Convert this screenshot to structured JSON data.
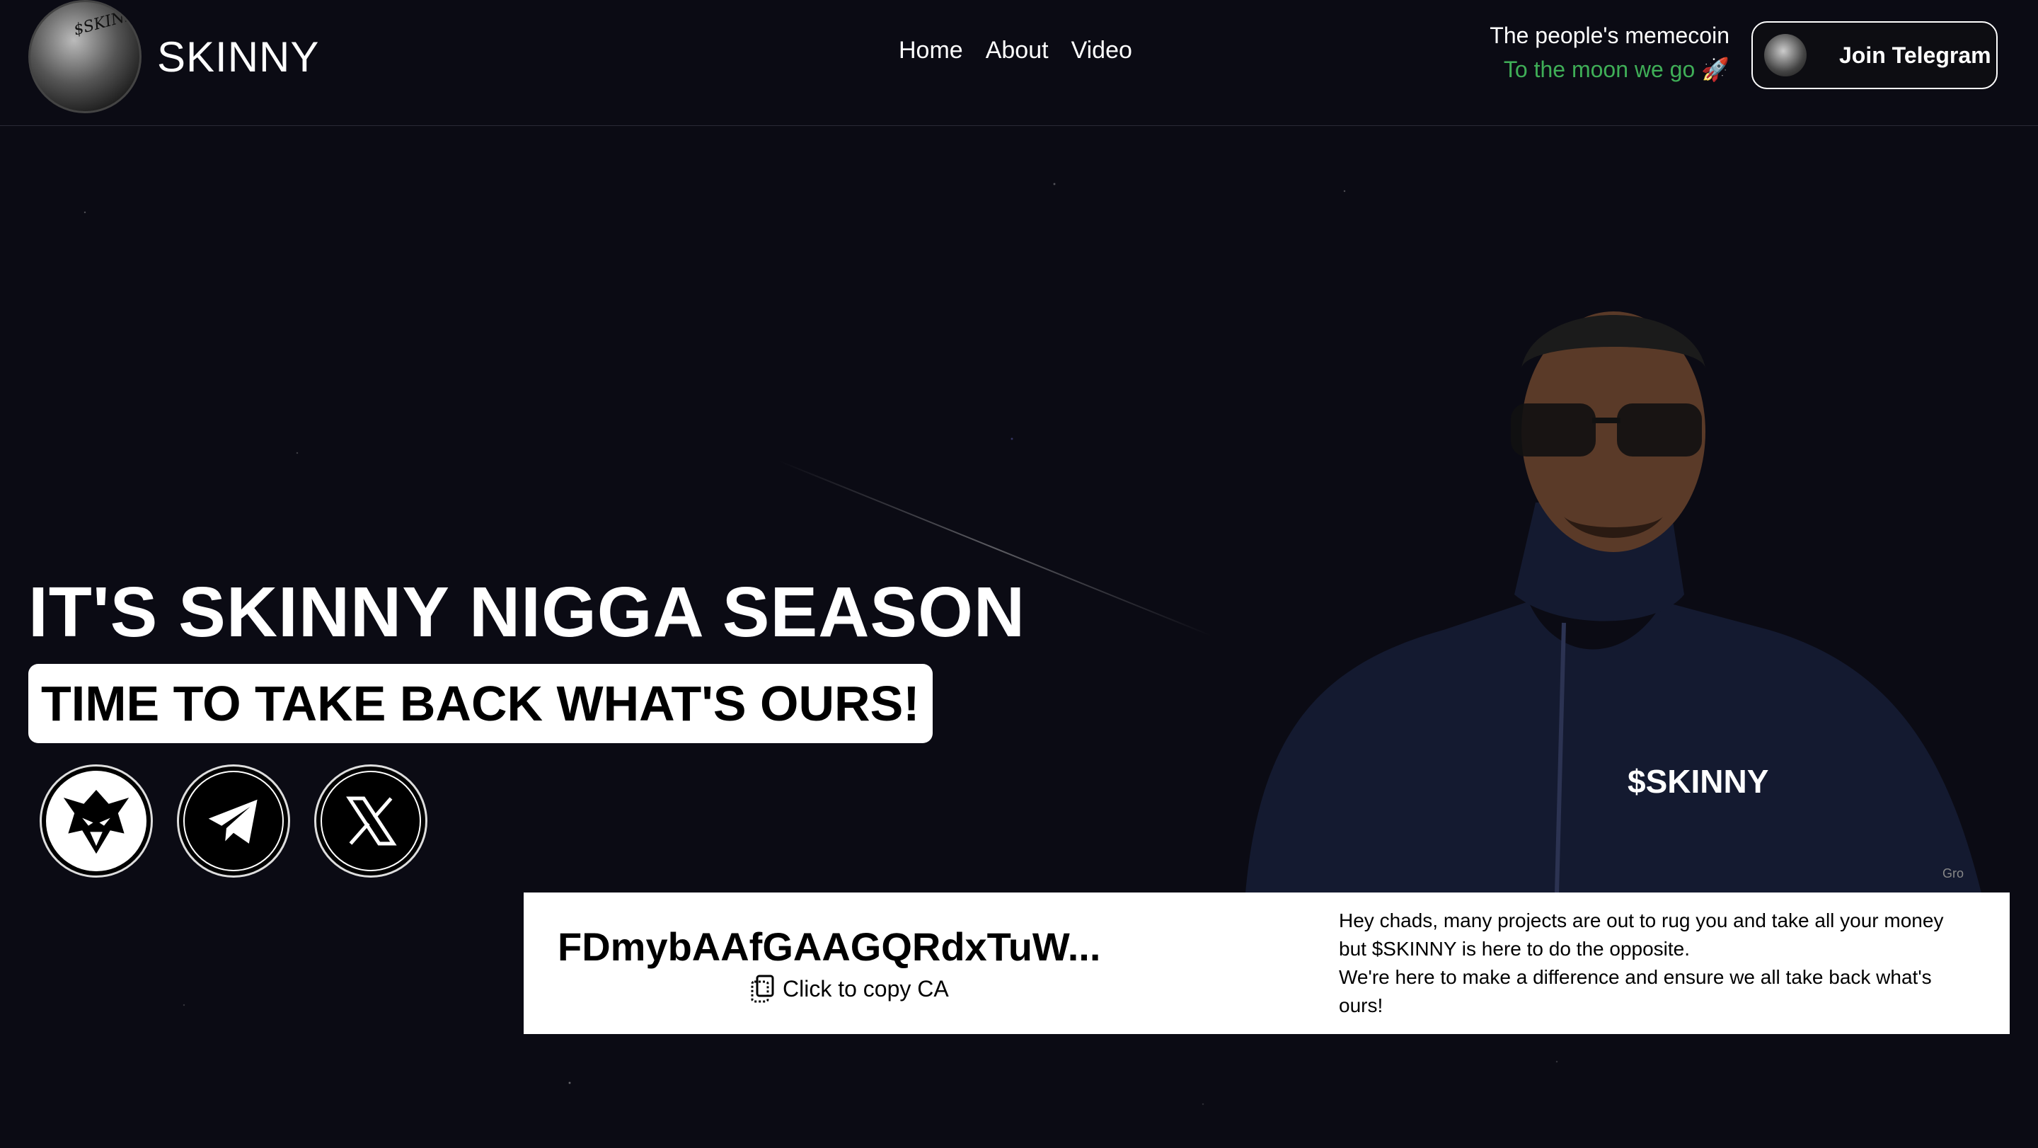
{
  "header": {
    "brand_name": "SKINNY",
    "logo_text": "$SKINNY",
    "nav": [
      "Home",
      "About",
      "Video"
    ],
    "tagline_primary": "The people's memecoin",
    "tagline_secondary": "To the moon we go 🚀",
    "join_label": "Join Telegram"
  },
  "hero": {
    "title": "IT'S SKINNY NIGGA SEASON",
    "subtitle": "TIME TO TAKE BACK WHAT'S OURS!",
    "jacket_text": "$SKINNY",
    "socials": [
      {
        "icon": "eagle-icon"
      },
      {
        "icon": "telegram-icon"
      },
      {
        "icon": "x-icon"
      }
    ]
  },
  "ca": {
    "address": "FDmybAAfGAAGQRdxTuW...",
    "copy_label": "Click to copy CA",
    "description_1": "Hey chads, many projects are out to rug you and take all your money but $SKINNY is here to do the opposite.",
    "description_2": "We're here to make a difference and ensure we all take back what's ours!"
  },
  "watermark": "Gro",
  "colors": {
    "background": "#0b0b14",
    "accent_green": "#3fae57",
    "card": "#ffffff"
  }
}
